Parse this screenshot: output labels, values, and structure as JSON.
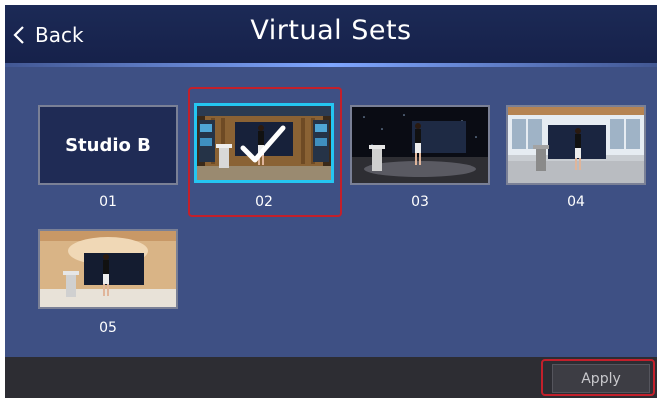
{
  "header": {
    "back_label": "Back",
    "title": "Virtual Sets"
  },
  "sets": [
    {
      "label": "01",
      "thumb_text": "Studio B"
    },
    {
      "label": "02"
    },
    {
      "label": "03"
    },
    {
      "label": "04"
    },
    {
      "label": "05"
    }
  ],
  "footer": {
    "apply_label": "Apply"
  },
  "colors": {
    "header_bg": "#1c2a56",
    "panel_bg": "#3e5084",
    "selected_border": "#24c6f2",
    "highlight_outline": "#c3202b",
    "footer_bg": "#2d2d33"
  }
}
